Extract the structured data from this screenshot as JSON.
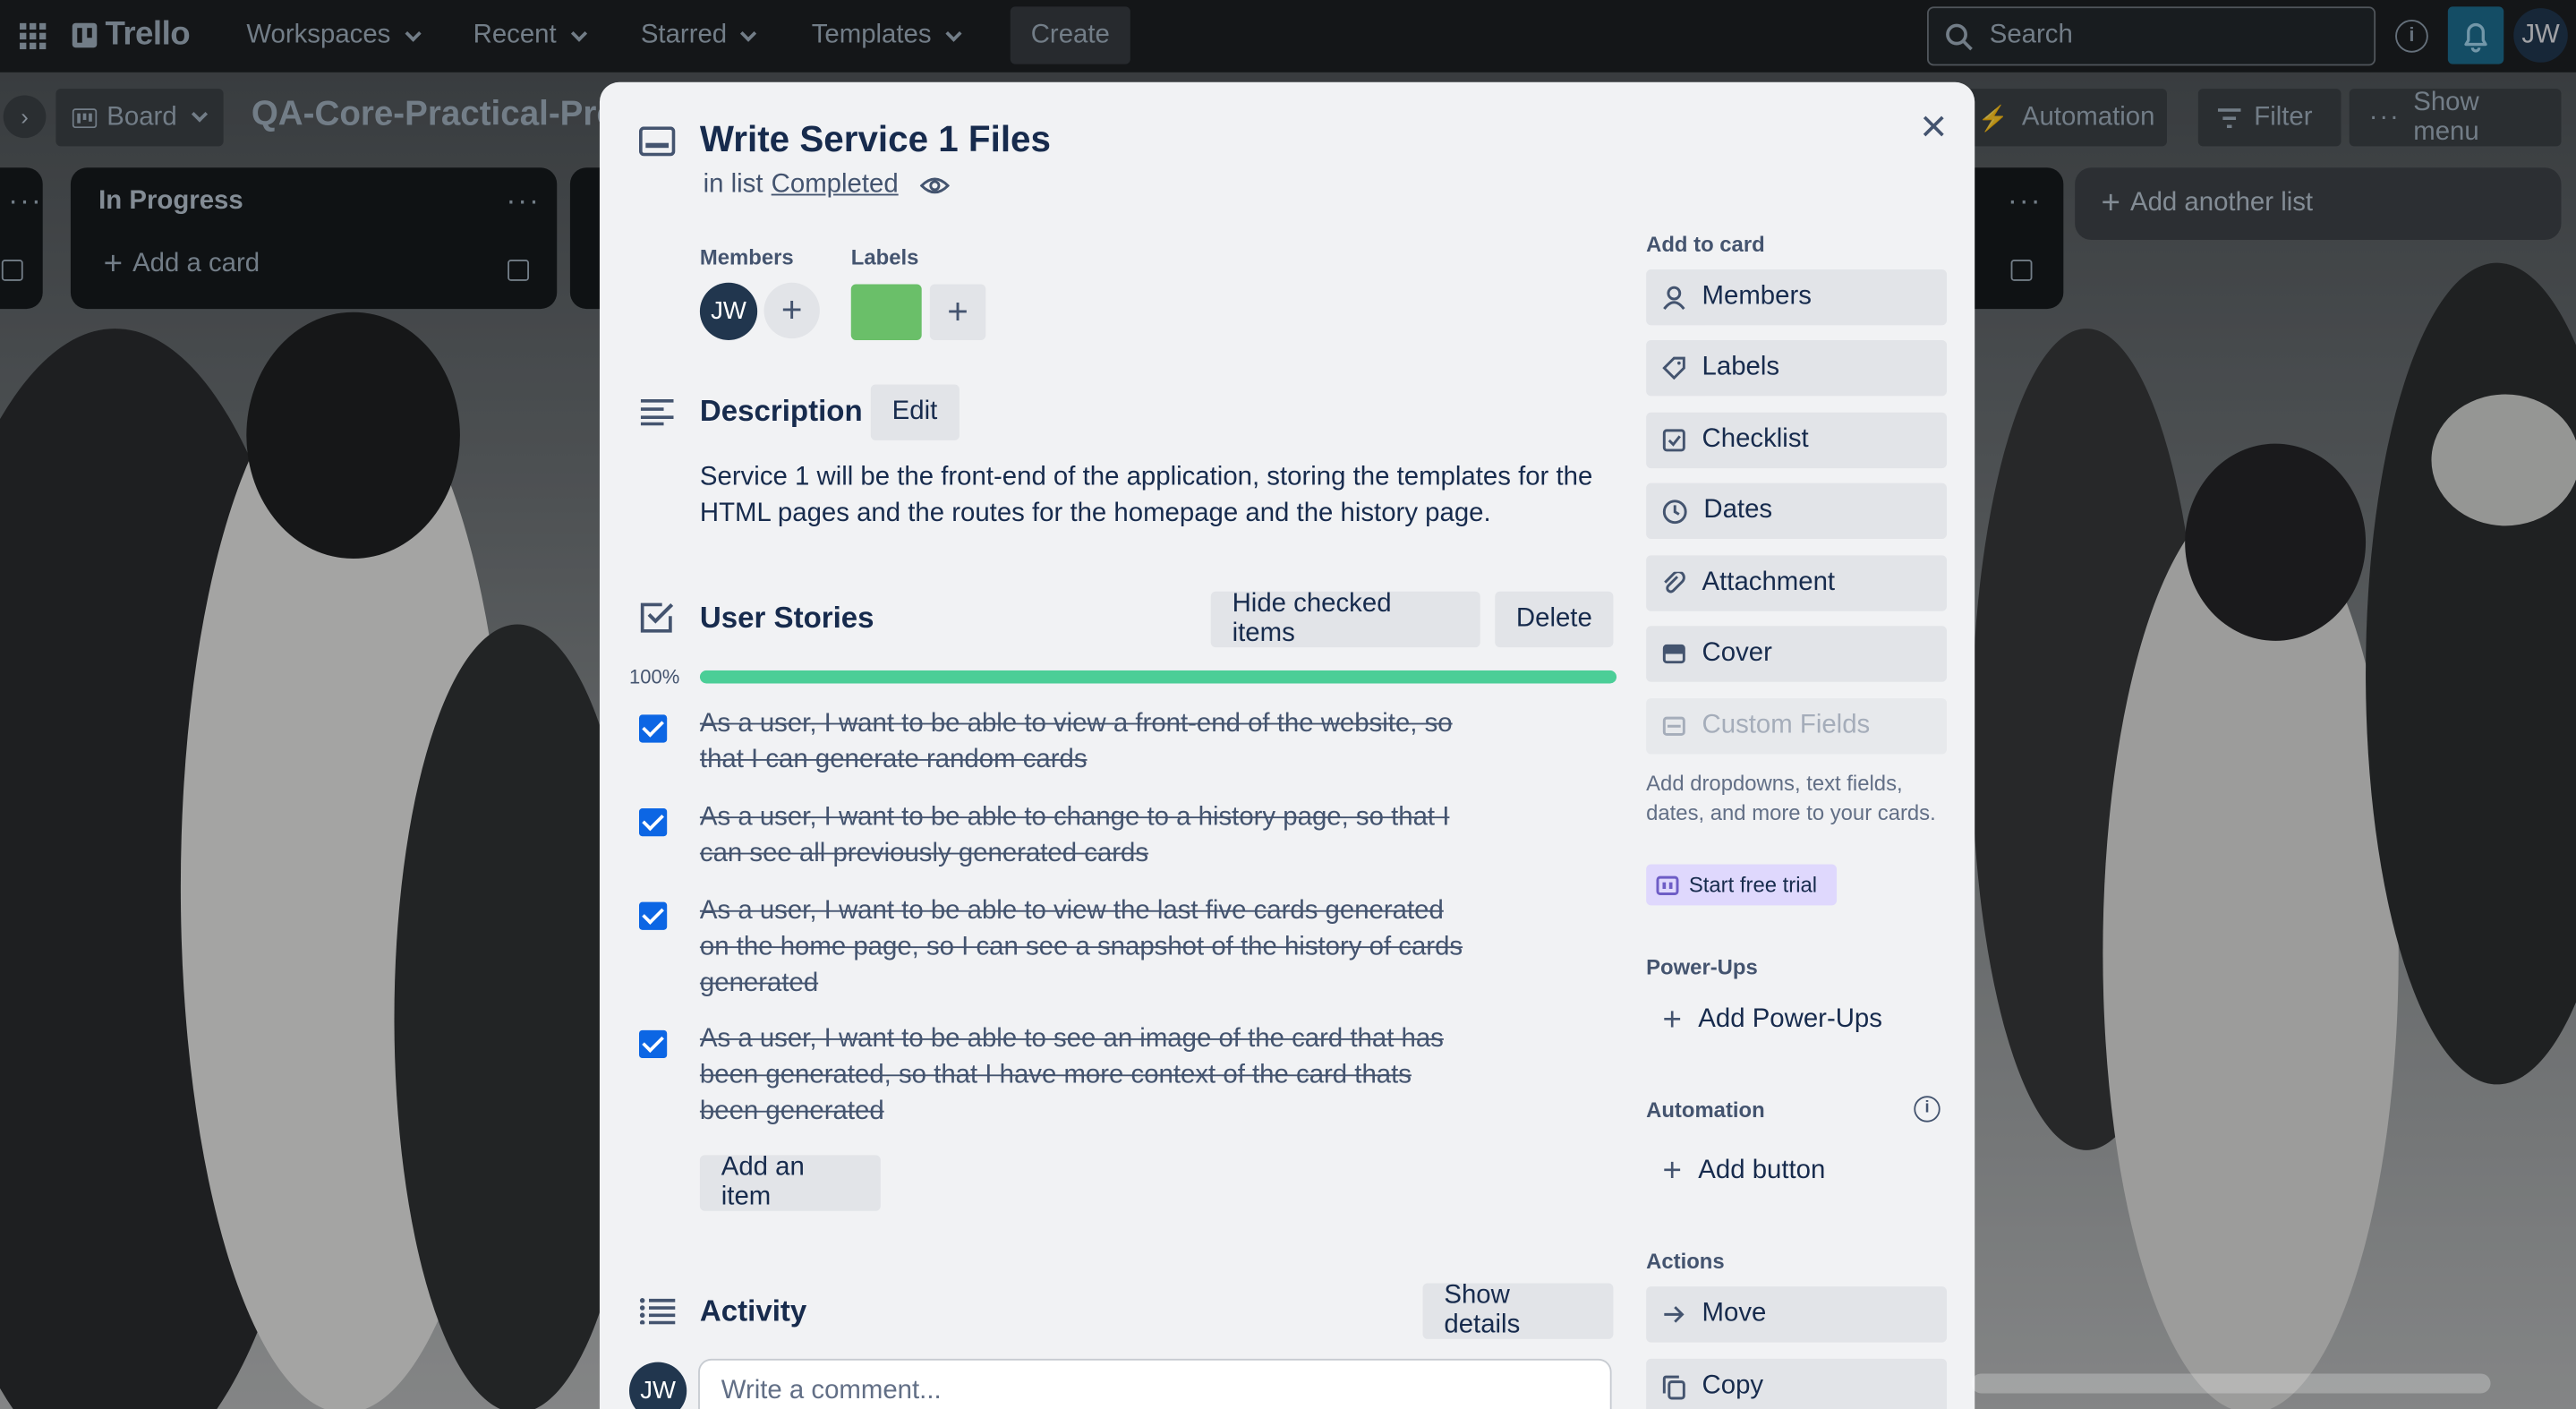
{
  "nav": {
    "logo": "Trello",
    "menus": [
      "Workspaces",
      "Recent",
      "Starred",
      "Templates"
    ],
    "create": "Create",
    "search_placeholder": "Search",
    "avatar": "JW"
  },
  "board": {
    "view": "Board",
    "title": "QA-Core-Practical-Pro",
    "automation": "Automation",
    "filter": "Filter",
    "show_menu": "Show menu",
    "add_list": "Add another list",
    "lists": [
      {
        "title": "In Progress",
        "add_card": "Add a card"
      }
    ]
  },
  "card": {
    "title": "Write Service 1 Files",
    "in_list_prefix": "in list",
    "list_name": "Completed",
    "members_label": "Members",
    "labels_label": "Labels",
    "member_initials": "JW",
    "label_color": "#6abf69",
    "description": {
      "heading": "Description",
      "edit": "Edit",
      "text": "Service 1 will be the front-end of the application, storing the templates for the HTML pages and the routes for the homepage and the history page."
    },
    "checklist": {
      "heading": "User Stories",
      "hide_checked": "Hide checked items",
      "delete": "Delete",
      "progress_label": "100%",
      "progress": 1.0,
      "items": [
        {
          "text": "As a user, I want to be able to view a front-end of the website, so that I can generate random cards",
          "checked": true
        },
        {
          "text": "As a user, I want to be able to change to a history page, so that I can see all previously generated cards",
          "checked": true
        },
        {
          "text": "As a user, I want to be able to view the last five cards generated on the home page, so I can see a snapshot of the history of cards generated",
          "checked": true
        },
        {
          "text": "As a user, I want to be able to see an image of the card that has been generated, so that I have more context of the card thats been generated",
          "checked": true
        }
      ],
      "add_item": "Add an item"
    },
    "activity": {
      "heading": "Activity",
      "show_details": "Show details",
      "comment_placeholder": "Write a comment..."
    }
  },
  "sidebar": {
    "add_to_card": "Add to card",
    "add_items": [
      "Members",
      "Labels",
      "Checklist",
      "Dates",
      "Attachment",
      "Cover"
    ],
    "custom_fields": "Custom Fields",
    "custom_fields_note": "Add dropdowns, text fields, dates, and more to your cards.",
    "start_trial": "Start free trial",
    "power_ups": "Power-Ups",
    "add_power_ups": "Add Power-Ups",
    "automation": "Automation",
    "add_button": "Add button",
    "actions": "Actions",
    "move": "Move",
    "copy": "Copy"
  },
  "colors": {
    "accent_blue": "#0c66e4",
    "progress_green": "#4bce97",
    "nav_bg": "#1c1f22"
  }
}
